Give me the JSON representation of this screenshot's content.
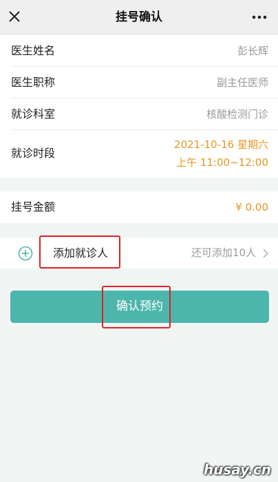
{
  "navbar": {
    "title": "挂号确认",
    "close_icon": "close-icon",
    "more_icon": "more-dots-icon"
  },
  "details": [
    {
      "label": "医生姓名",
      "value": "彭长辉"
    },
    {
      "label": "医生职称",
      "value": "副主任医师"
    },
    {
      "label": "就诊科室",
      "value": "核酸检测门诊"
    }
  ],
  "time_slot": {
    "label": "就诊时段",
    "date_line": "2021-10-16 星期六",
    "time_line": "上午 11:00~12:00"
  },
  "fee": {
    "label": "挂号金额",
    "value": "¥ 0.00"
  },
  "add_patient": {
    "icon": "add-circle-icon",
    "label": "添加就诊人",
    "hint": "还可添加10人"
  },
  "confirm_button": {
    "label": "确认预约"
  },
  "watermark": "husay.cn",
  "colors": {
    "accent": "#4db6ac",
    "highlight_value": "#e8961f",
    "annotation_box": "#e02020"
  }
}
